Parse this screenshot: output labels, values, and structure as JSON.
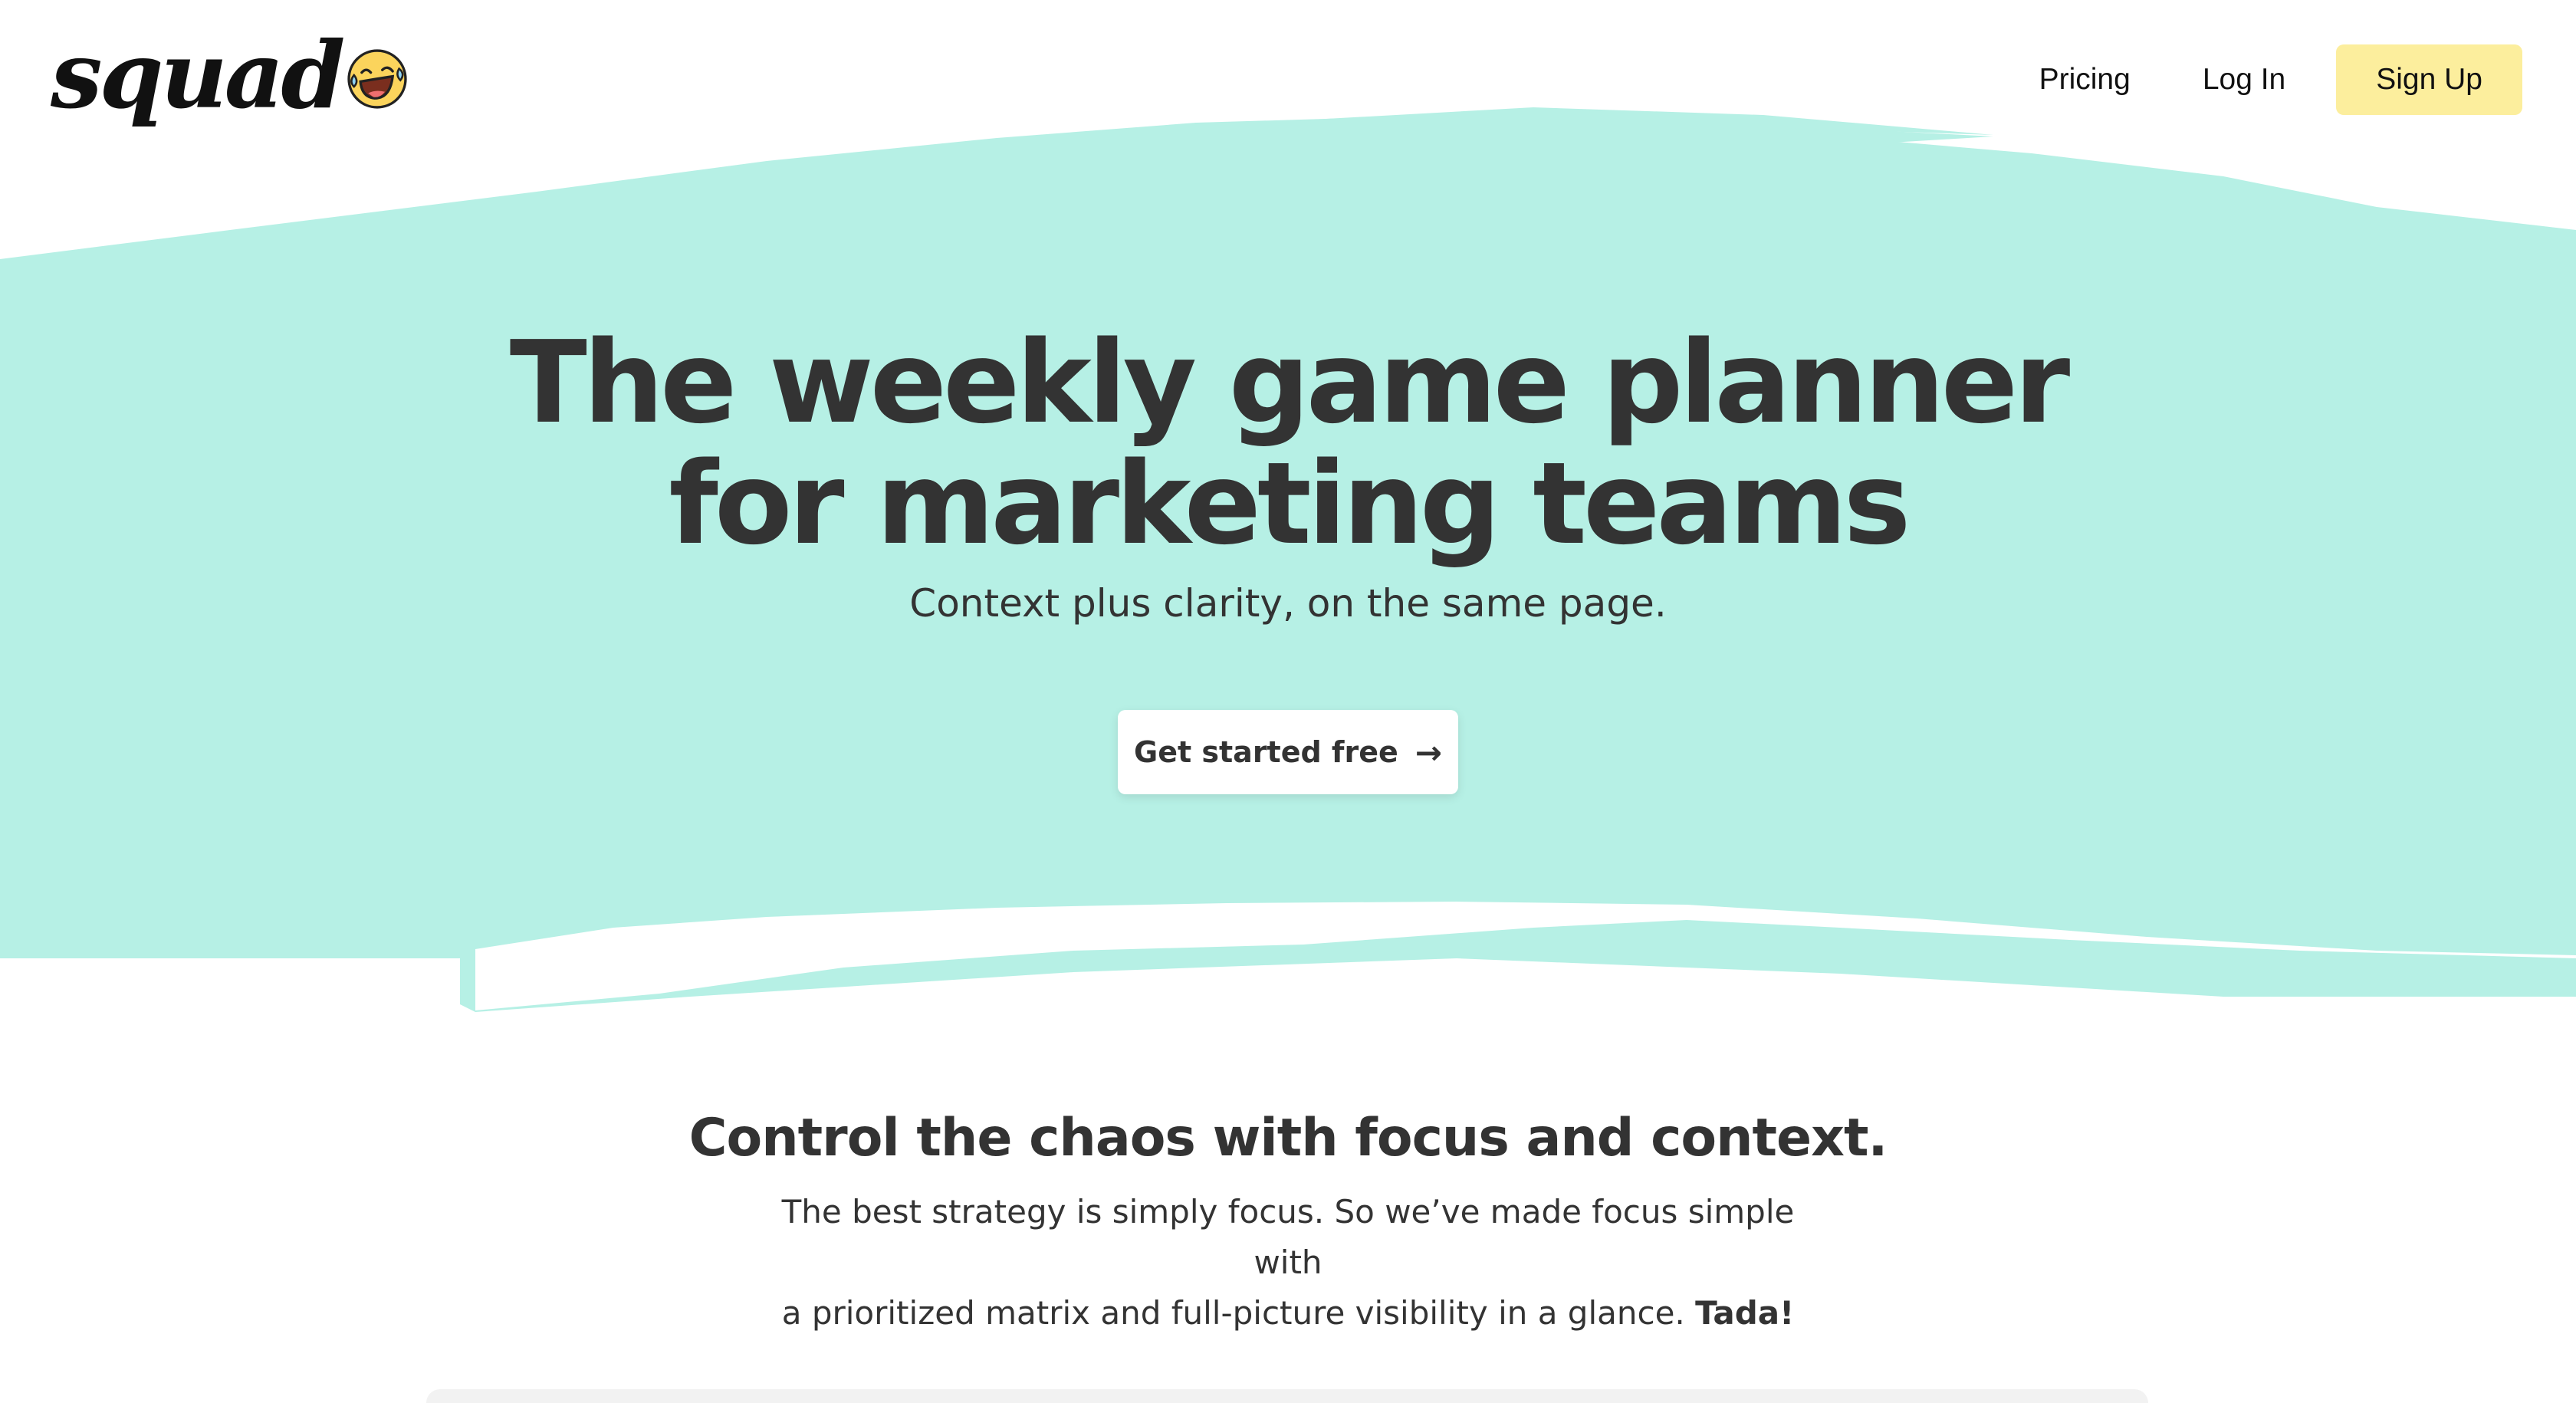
{
  "header": {
    "logo_text": "squad",
    "logo_icon": "laughing-face-icon",
    "nav": {
      "pricing": "Pricing",
      "login": "Log In",
      "signup": "Sign Up"
    }
  },
  "hero": {
    "title_line1": "The weekly game planner",
    "title_line2": "for marketing teams",
    "subtitle": "Context plus clarity, on the same page.",
    "cta_label": "Get started free",
    "cta_icon": "arrow-right-icon"
  },
  "features": {
    "heading": "Control the chaos with focus and context.",
    "body_line1": "The best strategy is simply focus. So we’ve made focus simple with",
    "body_line2": "a prioritized matrix and full-picture visibility in a glance.",
    "body_emphasis": "Tada!"
  },
  "colors": {
    "brush": "#b6f0e5",
    "signup_bg": "#fcee9d",
    "text": "#333333",
    "emoji_face": "#fbd45c"
  }
}
